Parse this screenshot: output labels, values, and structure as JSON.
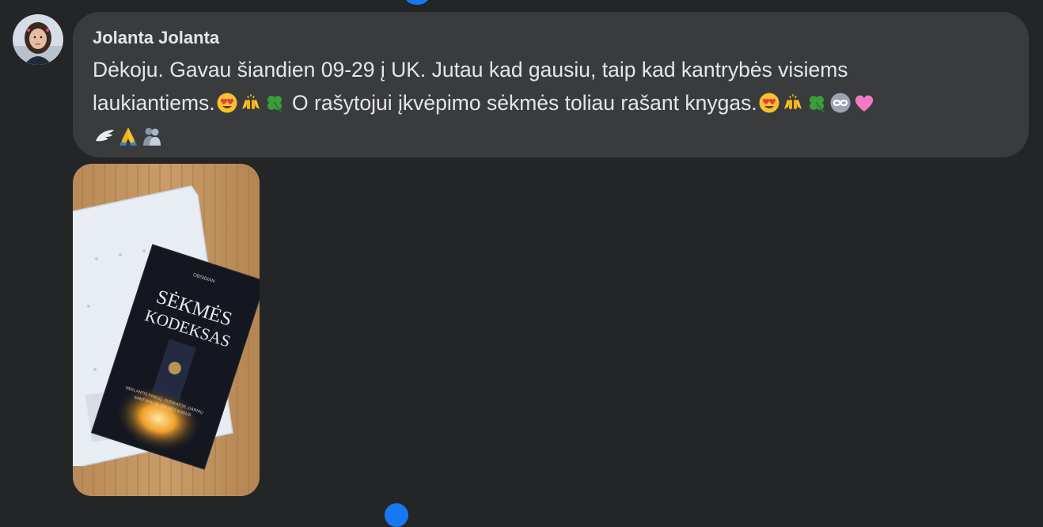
{
  "comment": {
    "author": "Jolanta Jolanta",
    "text_line1": "Dėkoju. Gavau šiandien 09-29 į UK. Jutau kad gausiu, taip kad kantrybės visiems",
    "text_line2a": "laukiantiems.",
    "text_line2b": " O rašytojui įkvėpimo sėkmės toliau rašant knygas.",
    "emojis_1": [
      "heart-eyes-icon",
      "raising-hands-icon",
      "four-leaf-clover-icon"
    ],
    "emojis_2": [
      "heart-eyes-icon",
      "raising-hands-icon",
      "four-leaf-clover-icon",
      "infinity-icon",
      "pink-heart-icon"
    ],
    "emojis_3": [
      "wing-icon",
      "folded-hands-icon",
      "hugging-people-icon"
    ]
  },
  "photo": {
    "book_publisher": "OBSIDIAN",
    "book_title_line1": "SĖKMĖS",
    "book_title_line2": "KODEKSAS",
    "book_subtitle_line1": "NEKLANTIS PINIGŲ, SVEIKATOS, DARNIŲ",
    "book_subtitle_line2": "SANTYKIŲ IR SĖKMĖS KODUS"
  },
  "colors": {
    "background": "#242526",
    "bubble": "#3a3b3c",
    "text": "#e4e6eb",
    "reaction_blue": "#1877f2"
  }
}
